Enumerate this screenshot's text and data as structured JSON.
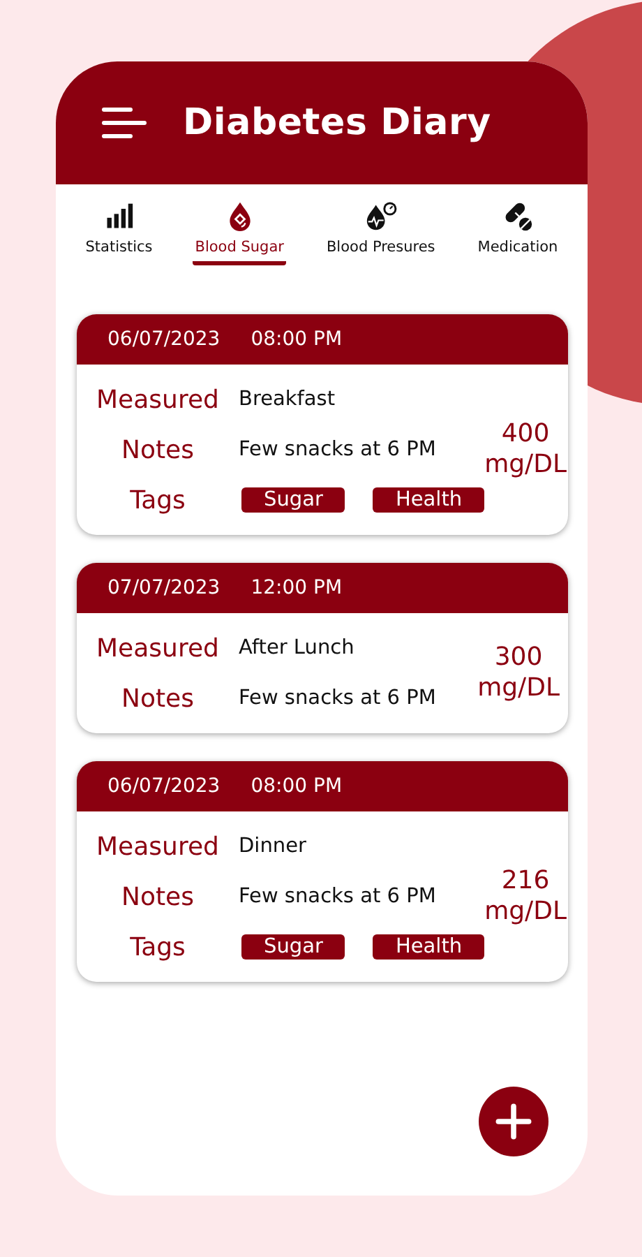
{
  "app_bar": {
    "title": "Diabetes Diary"
  },
  "tabs": [
    {
      "label": "Statistics",
      "kind": "bars",
      "selected": false
    },
    {
      "label": "Blood Sugar",
      "kind": "drop",
      "selected": true
    },
    {
      "label": "Blood Presures",
      "kind": "pressure",
      "selected": false
    },
    {
      "label": "Medication",
      "kind": "pills",
      "selected": false
    }
  ],
  "entries": [
    {
      "date": "06/07/2023",
      "time": "08:00 PM",
      "reading": "400",
      "unit": "mg/DL",
      "rows": [
        {
          "kind": "text",
          "label": "Measured",
          "value": "Breakfast"
        },
        {
          "kind": "text",
          "label": "Notes",
          "value": "Few snacks at 6 PM"
        },
        {
          "kind": "tags",
          "label": "Tags",
          "tags": [
            "Sugar",
            "Health"
          ]
        }
      ]
    },
    {
      "date": "07/07/2023",
      "time": "12:00 PM",
      "reading": "300",
      "unit": "mg/DL",
      "rows": [
        {
          "kind": "text",
          "label": "Measured",
          "value": "After Lunch"
        },
        {
          "kind": "text",
          "label": "Notes",
          "value": "Few snacks at 6 PM"
        }
      ]
    },
    {
      "date": "06/07/2023",
      "time": "08:00 PM",
      "reading": "216",
      "unit": "mg/DL",
      "rows": [
        {
          "kind": "text",
          "label": "Measured",
          "value": "Dinner"
        },
        {
          "kind": "text",
          "label": "Notes",
          "value": "Few snacks at 6 PM"
        },
        {
          "kind": "tags",
          "label": "Tags",
          "tags": [
            "Sugar",
            "Health"
          ]
        }
      ]
    }
  ]
}
